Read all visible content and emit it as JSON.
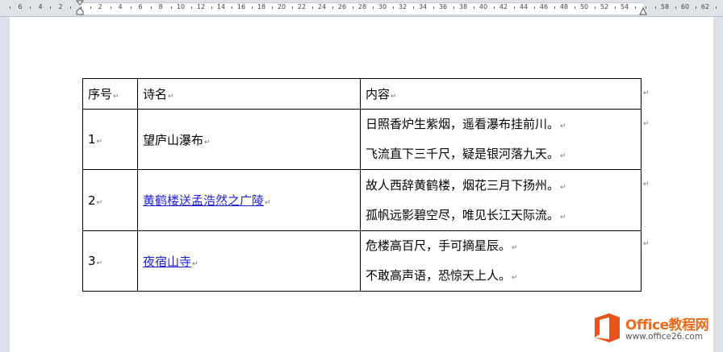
{
  "ruler": {
    "labels": [
      "6",
      "4",
      "2",
      "2",
      "4",
      "6",
      "8",
      "10",
      "12",
      "14",
      "16",
      "18",
      "20",
      "22",
      "24",
      "26",
      "28",
      "30",
      "32",
      "34",
      "36",
      "38",
      "40",
      "42",
      "44",
      "46",
      "48",
      "50",
      "52",
      "54",
      "58",
      "60",
      "62"
    ]
  },
  "table": {
    "headers": [
      "序号",
      "诗名",
      "内容"
    ],
    "rows": [
      {
        "num": "1",
        "title": "望庐山瀑布",
        "linked": false,
        "lines": [
          "日照香炉生紫烟，遥看瀑布挂前川。",
          "飞流直下三千尺，疑是银河落九天。"
        ]
      },
      {
        "num": "2",
        "title": "黄鹤楼送孟浩然之广陵",
        "linked": true,
        "lines": [
          "故人西辞黄鹤楼，烟花三月下扬州。",
          "孤帆远影碧空尽，唯见长江天际流。"
        ]
      },
      {
        "num": "3",
        "title": "夜宿山寺",
        "linked": true,
        "lines": [
          "危楼高百尺，手可摘星辰。",
          "不敢高声语，恐惊天上人。"
        ]
      }
    ],
    "end_mark": "↵"
  },
  "logo": {
    "name": "Office教程网",
    "url": "www.office26.com",
    "icon": "office-logo-icon",
    "brand_color": "#e8541a"
  }
}
